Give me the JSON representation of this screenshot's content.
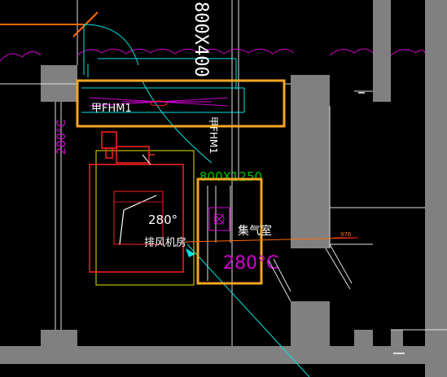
{
  "drawing": {
    "labels": {
      "door_top": "甲FHM1",
      "door_right": "甲FHM1",
      "dim_vertical": "800X400",
      "side_temp": "280°C",
      "duct_size": "800X1250",
      "fan_temp": "280°",
      "fan_room": "排风机房",
      "plenum": "集气室",
      "plenum_temp": "280°C",
      "elevation": "976"
    },
    "colors": {
      "background": "#000000",
      "wall": "#808080",
      "highlight_box": "#f5a623",
      "cyan": "#00e5e5",
      "magenta": "#d000d0",
      "red": "#ff2020",
      "yellow": "#e6e600",
      "green": "#00c000",
      "orange": "#ff6a00",
      "white": "#ffffff"
    },
    "icons": [
      "exhaust-fan-icon",
      "motor-icon",
      "fire-valve-icon"
    ]
  }
}
